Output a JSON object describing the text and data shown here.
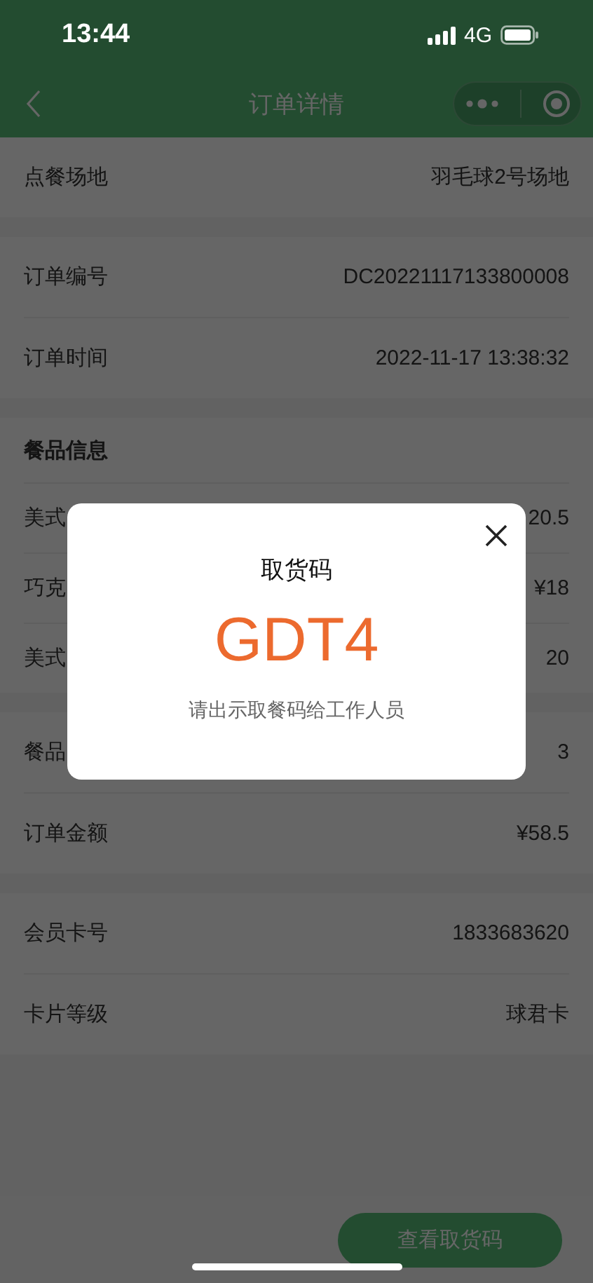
{
  "status_bar": {
    "time": "13:44",
    "network": "4G"
  },
  "nav": {
    "title": "订单详情"
  },
  "sections": [
    {
      "rows": [
        {
          "label": "点餐场地",
          "value": "羽毛球2号场地"
        }
      ]
    },
    {
      "rows": [
        {
          "label": "订单编号",
          "value": "DC20221117133800008"
        },
        {
          "label": "订单时间",
          "value": "2022-11-17 13:38:32"
        }
      ]
    },
    {
      "heading": "餐品信息",
      "items": [
        {
          "label": "美式",
          "value": "20.5"
        },
        {
          "label": "巧克",
          "value": "¥18"
        },
        {
          "label": "美式",
          "value": "20"
        }
      ]
    },
    {
      "rows": [
        {
          "label": "餐品",
          "value": "3"
        },
        {
          "label": "订单金额",
          "value": "¥58.5"
        }
      ]
    },
    {
      "rows": [
        {
          "label": "会员卡号",
          "value": "1833683620"
        },
        {
          "label": "卡片等级",
          "value": "球君卡"
        }
      ]
    }
  ],
  "footer_button": "查看取货码",
  "dialog": {
    "title": "取货码",
    "code": "GDT4",
    "hint": "请出示取餐码给工作人员"
  }
}
